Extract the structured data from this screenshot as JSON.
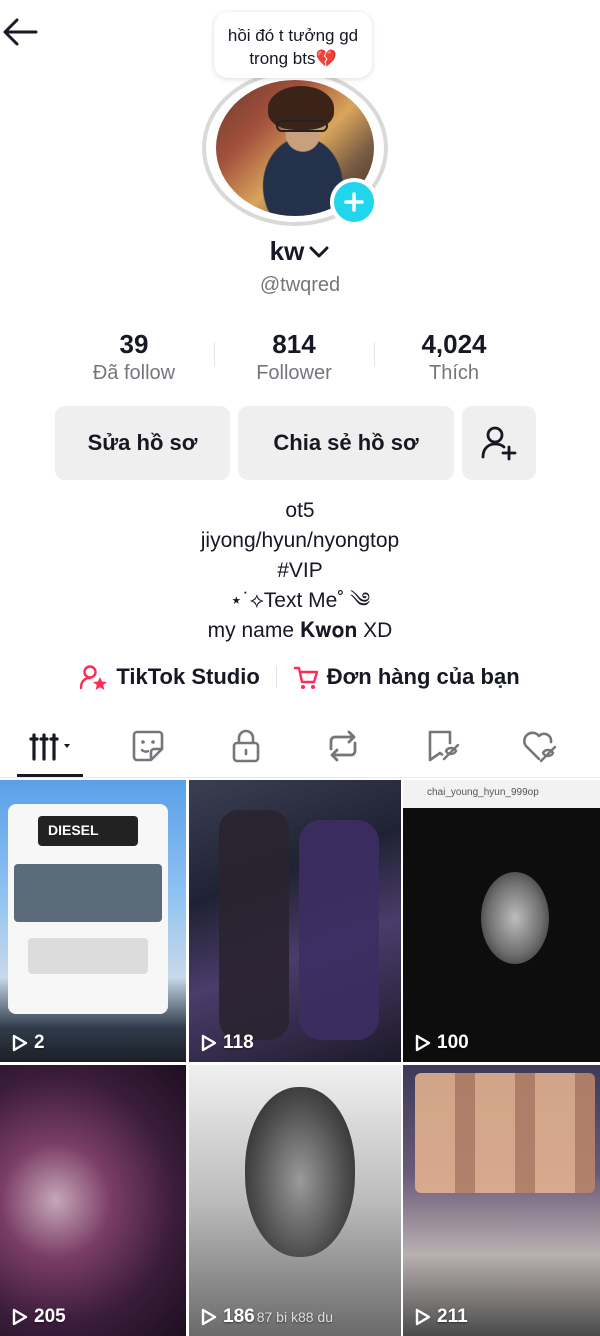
{
  "header": {
    "back_icon": "arrow-left-icon"
  },
  "profile": {
    "note": "hồi đó t tưởng gd trong bts💔",
    "username": "kw",
    "handle": "@twqred",
    "add_icon": "plus-icon"
  },
  "stats": [
    {
      "value": "39",
      "label": "Đã follow"
    },
    {
      "value": "814",
      "label": "Follower"
    },
    {
      "value": "4,024",
      "label": "Thích"
    }
  ],
  "actions": {
    "edit_label": "Sửa hồ sơ",
    "share_label": "Chia sẻ hồ sơ",
    "add_friend_icon": "person-add-icon"
  },
  "bio": {
    "line1": "ot5",
    "line2": "jiyong/hyun/nyongtop",
    "line3": "#VIP",
    "line4": "⋆˙⟡Text Me˚ ༄",
    "line5": "my name 𝐊𝐰𝐨𝐧 XD"
  },
  "links": {
    "studio_label": "TikTok Studio",
    "orders_label": "Đơn hàng của bạn",
    "accent_color": "#fe2c55"
  },
  "tabs": [
    {
      "icon": "videos-grid-icon",
      "active": true
    },
    {
      "icon": "sticker-icon",
      "active": false
    },
    {
      "icon": "lock-icon",
      "active": false
    },
    {
      "icon": "repost-icon",
      "active": false
    },
    {
      "icon": "favorites-icon",
      "active": false
    },
    {
      "icon": "liked-heart-icon",
      "active": false
    }
  ],
  "videos": [
    {
      "views": "2"
    },
    {
      "views": "118"
    },
    {
      "views": "100"
    },
    {
      "views": "205"
    },
    {
      "views": "186",
      "caption": "87 bi k88 du"
    },
    {
      "views": "211"
    }
  ],
  "video_c1_title": "DIESEL",
  "video_c3_username": "chai_young_hyun_999op"
}
